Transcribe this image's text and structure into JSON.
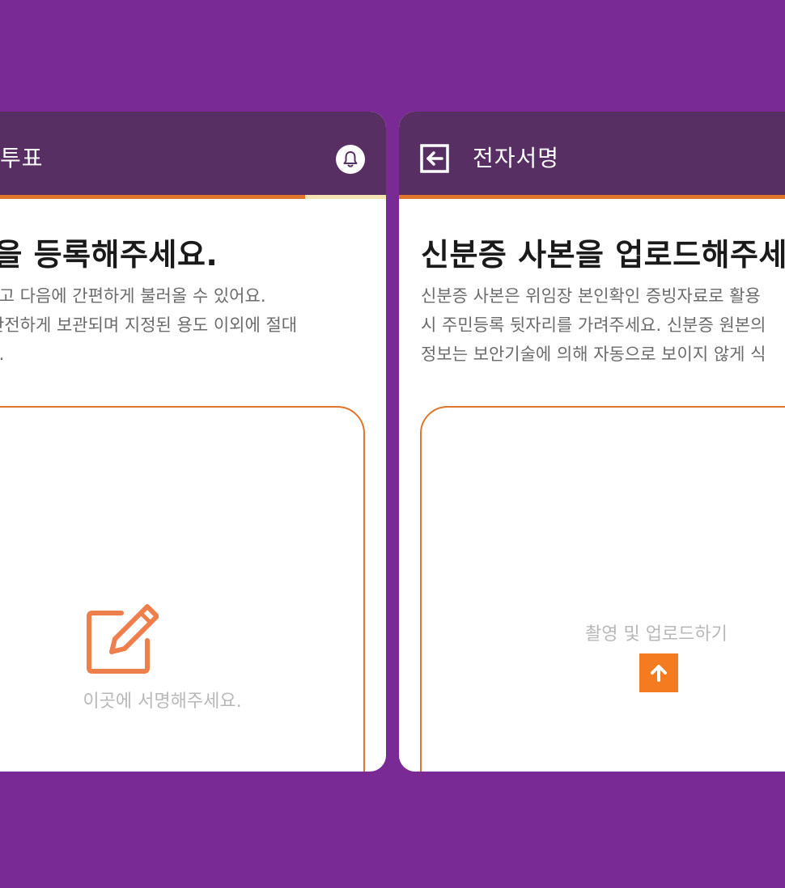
{
  "left_screen": {
    "title": "투표",
    "heading": "명을 등록해주세요.",
    "description": [
      "장하고 다음에 간편하게 불러올 수 있어요.",
      "는 안전하게 보관되며 지정된 용도 이외에 절대",
      "니다."
    ],
    "signature_placeholder": "이곳에 서명해주세요.",
    "icons": {
      "notification": "bell-icon",
      "signature": "edit-pencil-icon"
    }
  },
  "right_screen": {
    "title": "전자서명",
    "heading": "신분증 사본을 업로드해주세",
    "description": [
      "신분증 사본은 위임장 본인확인 증빙자료로 활용",
      "시 주민등록 뒷자리를 가려주세요. 신분증 원본의",
      "정보는 보안기술에 의해 자동으로 보이지 않게 식"
    ],
    "upload_label": "촬영 및 업로드하기",
    "icons": {
      "back": "back-arrow-icon",
      "upload": "arrow-up-icon"
    }
  },
  "colors": {
    "background": "#7a2a94",
    "appbar": "#582f63",
    "accent": "#e1752b",
    "upload_button": "#f47b20",
    "progress_thumb": "#f6e3b4"
  }
}
